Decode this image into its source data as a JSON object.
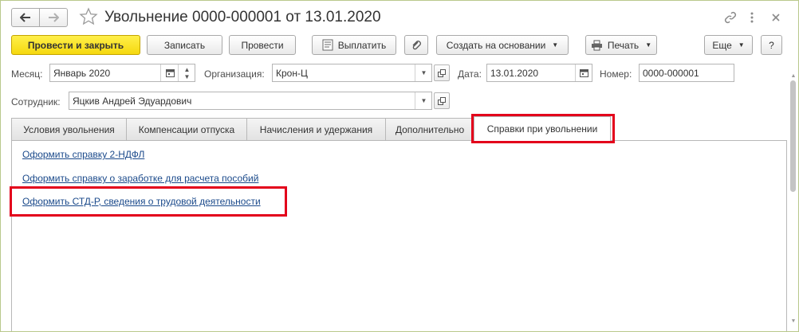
{
  "window": {
    "title": "Увольнение 0000-000001 от 13.01.2020"
  },
  "toolbar": {
    "post_close": "Провести и закрыть",
    "save": "Записать",
    "post": "Провести",
    "pay": "Выплатить",
    "create_based": "Создать на основании",
    "print": "Печать",
    "more": "Еще",
    "help": "?"
  },
  "form": {
    "month_label": "Месяц:",
    "month_value": "Январь 2020",
    "org_label": "Организация:",
    "org_value": "Крон-Ц",
    "date_label": "Дата:",
    "date_value": "13.01.2020",
    "number_label": "Номер:",
    "number_value": "0000-000001",
    "employee_label": "Сотрудник:",
    "employee_value": "Яцкив Андрей Эдуардович"
  },
  "tabs": [
    {
      "label": "Условия увольнения"
    },
    {
      "label": "Компенсации отпуска"
    },
    {
      "label": "Начисления и удержания"
    },
    {
      "label": "Дополнительно"
    },
    {
      "label": "Справки при увольнении",
      "active": true
    }
  ],
  "links": [
    {
      "label": "Оформить справку 2-НДФЛ"
    },
    {
      "label": "Оформить справку о заработке для расчета пособий"
    },
    {
      "label": "Оформить СТД-Р, сведения о трудовой деятельности"
    }
  ],
  "colors": {
    "primary_button": "#f5d80f",
    "link": "#1b4a8b",
    "highlight": "#e3001b",
    "window_border": "#b9c98c"
  }
}
